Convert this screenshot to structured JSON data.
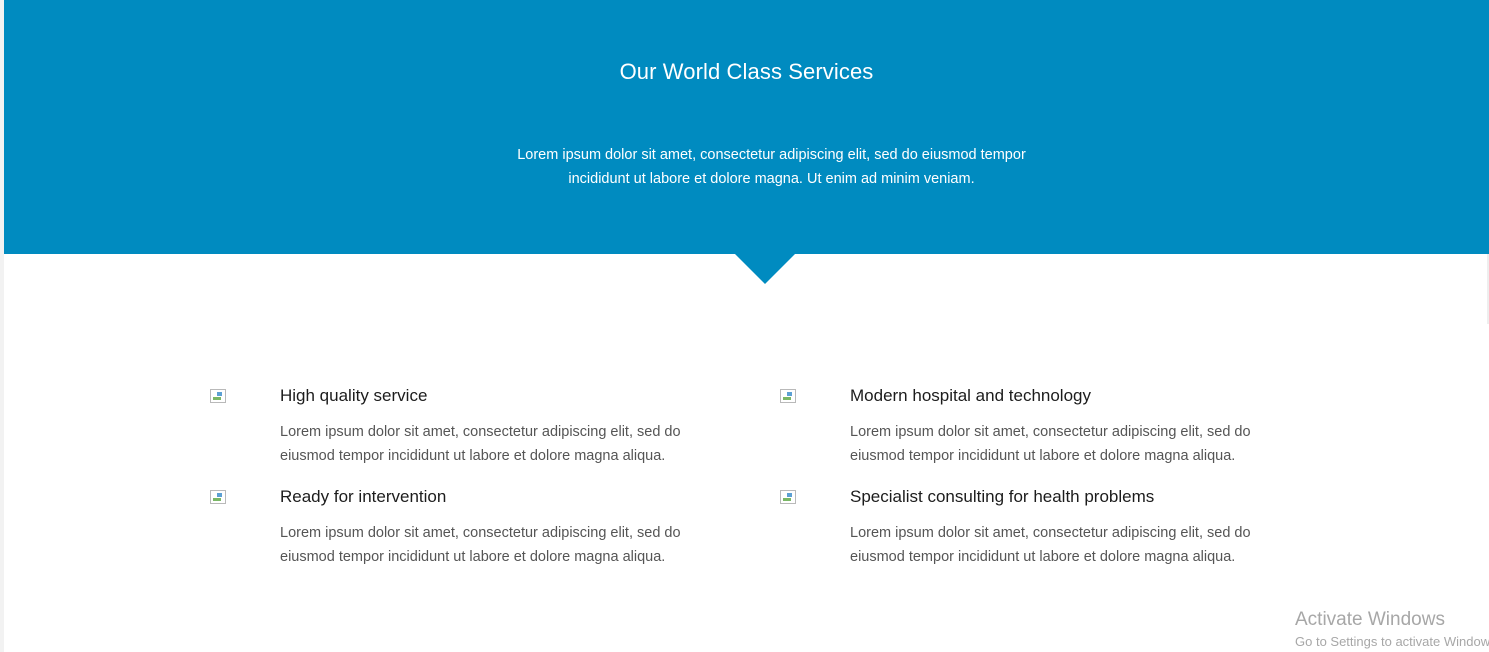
{
  "colors": {
    "accent": "#008bc0",
    "background": "#ffffff",
    "title_text": "#1c1c1c",
    "body_text": "#555555",
    "watermark_text": "#a7a7a7"
  },
  "hero": {
    "title": "Our World Class Services",
    "description": "Lorem ipsum dolor sit amet, consectetur adipiscing elit, sed do eiusmod tempor incididunt ut labore et dolore magna. Ut enim ad minim veniam."
  },
  "services": [
    {
      "icon": "broken-image-icon",
      "title": "High quality service",
      "description": "Lorem ipsum dolor sit amet, consectetur adipiscing elit, sed do eiusmod tempor incididunt ut labore et dolore magna aliqua."
    },
    {
      "icon": "broken-image-icon",
      "title": "Modern hospital and technology",
      "description": "Lorem ipsum dolor sit amet, consectetur adipiscing elit, sed do eiusmod tempor incididunt ut labore et dolore magna aliqua."
    },
    {
      "icon": "broken-image-icon",
      "title": "Ready for intervention",
      "description": "Lorem ipsum dolor sit amet, consectetur adipiscing elit, sed do eiusmod tempor incididunt ut labore et dolore magna aliqua."
    },
    {
      "icon": "broken-image-icon",
      "title": "Specialist consulting for health problems",
      "description": "Lorem ipsum dolor sit amet, consectetur adipiscing elit, sed do eiusmod tempor incididunt ut labore et dolore magna aliqua."
    }
  ],
  "watermark": {
    "title": "Activate Windows",
    "subtitle": "Go to Settings to activate Windows."
  }
}
